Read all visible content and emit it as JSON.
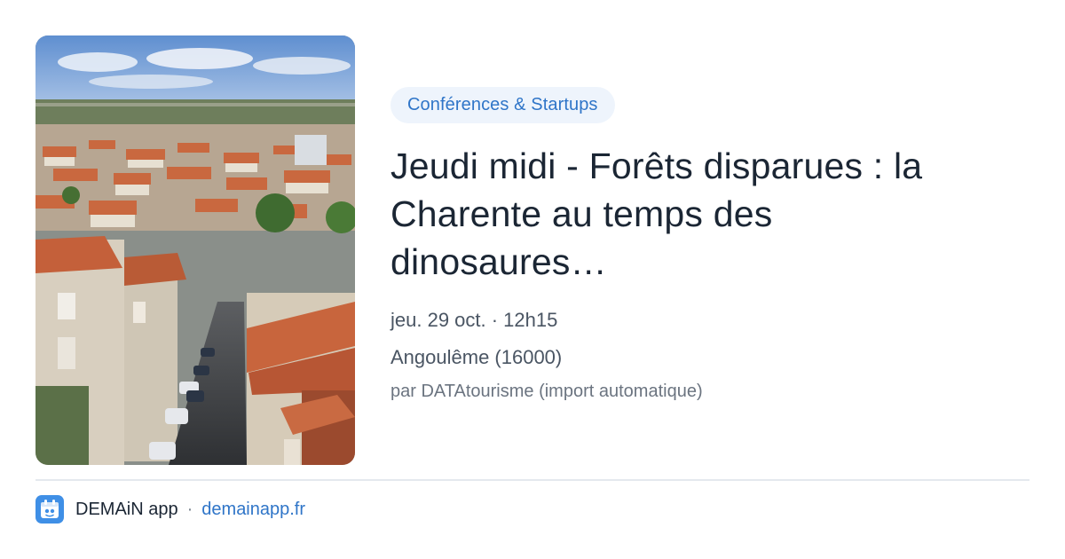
{
  "event": {
    "category": "Conférences & Startups",
    "title_lines": [
      "Jeudi midi - Forêts disparues : la",
      "Charente au temps des",
      "dinosaures…"
    ],
    "date": "jeu. 29 oct. · 12h15",
    "location": "Angoulême (16000)",
    "source": "par DATAtourisme (import automatique)"
  },
  "footer": {
    "app_name": "DEMAiN app",
    "separator": "·",
    "domain": "demainapp.fr"
  },
  "colors": {
    "accent": "#2f75c8",
    "tag_background": "#eef4fc",
    "app_icon": "#3f8fe6"
  },
  "icons": {
    "app": "demain-app-icon"
  }
}
